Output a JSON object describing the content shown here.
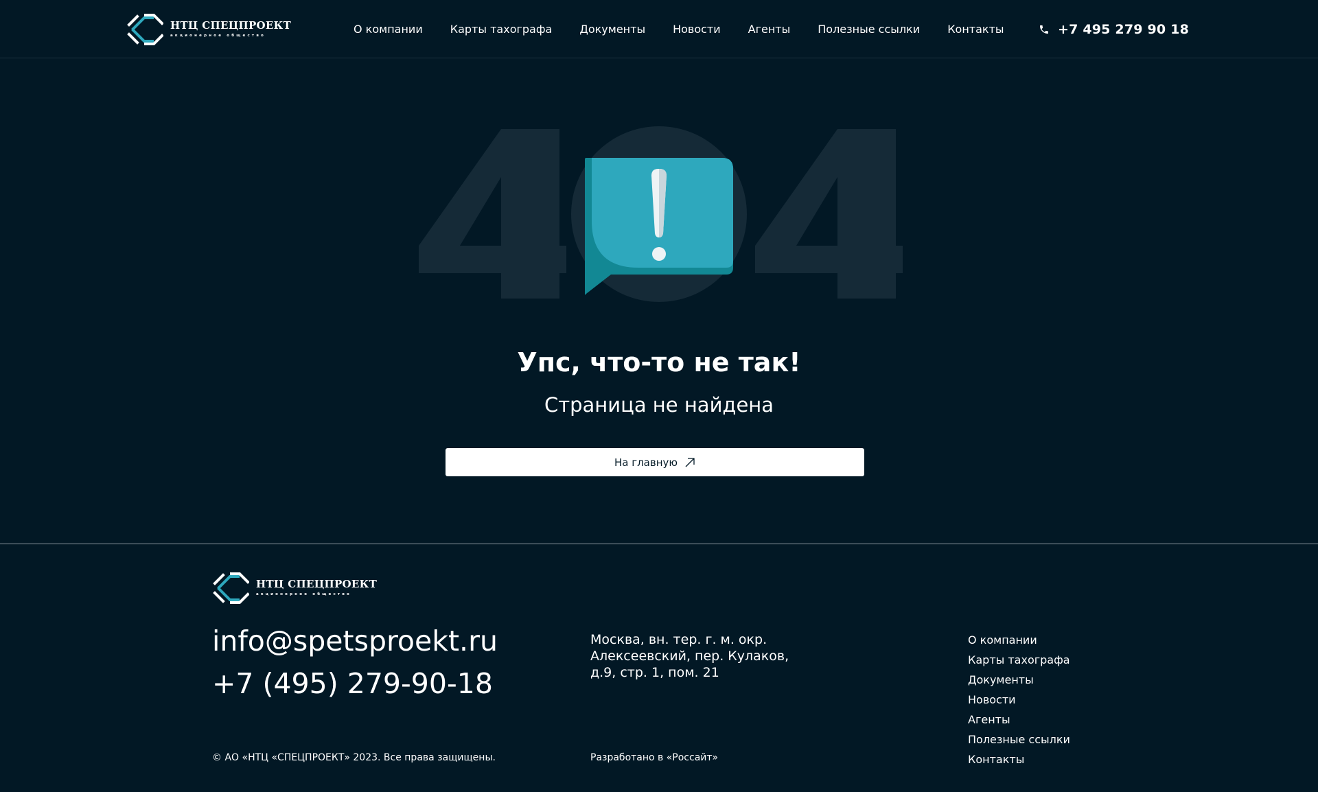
{
  "brand": {
    "name": "НТЦ СПЕЦПРОЕКТ",
    "subtitle": "акционерное общество",
    "accent_color": "#2ea8bd"
  },
  "header": {
    "nav": [
      {
        "label": "О компании"
      },
      {
        "label": "Карты тахографа"
      },
      {
        "label": "Документы"
      },
      {
        "label": "Новости"
      },
      {
        "label": "Агенты"
      },
      {
        "label": "Полезные ссылки"
      },
      {
        "label": "Контакты"
      }
    ],
    "phone": "+7 495 279 90 18",
    "phone_icon": "phone-icon"
  },
  "error": {
    "code": "404",
    "icon": "exclamation-speech-bubble-icon",
    "headline": "Упс, что-то не так!",
    "message": "Страница не найдена",
    "button_label": "На главную",
    "button_icon": "arrow-up-right-icon"
  },
  "footer": {
    "email": "info@spetsproekt.ru",
    "phone": "+7 (495) 279-90-18",
    "address": "Москва, вн. тер. г. м. окр. Алексеевский, пер. Кулаков, д.9, стр. 1, пом. 21",
    "nav": [
      {
        "label": "О компании"
      },
      {
        "label": "Карты тахографа"
      },
      {
        "label": "Документы"
      },
      {
        "label": "Новости"
      },
      {
        "label": "Агенты"
      },
      {
        "label": "Полезные ссылки"
      },
      {
        "label": "Контакты"
      }
    ],
    "copyright": "© АО «НТЦ «СПЕЦПРОЕКТ» 2023. Все права защищены.",
    "developer": "Разработано в «Россайт»"
  },
  "colors": {
    "background": "#021825",
    "digits": "#152a37",
    "bubble": "#2ea8bd",
    "bubble_dark": "#128894"
  }
}
